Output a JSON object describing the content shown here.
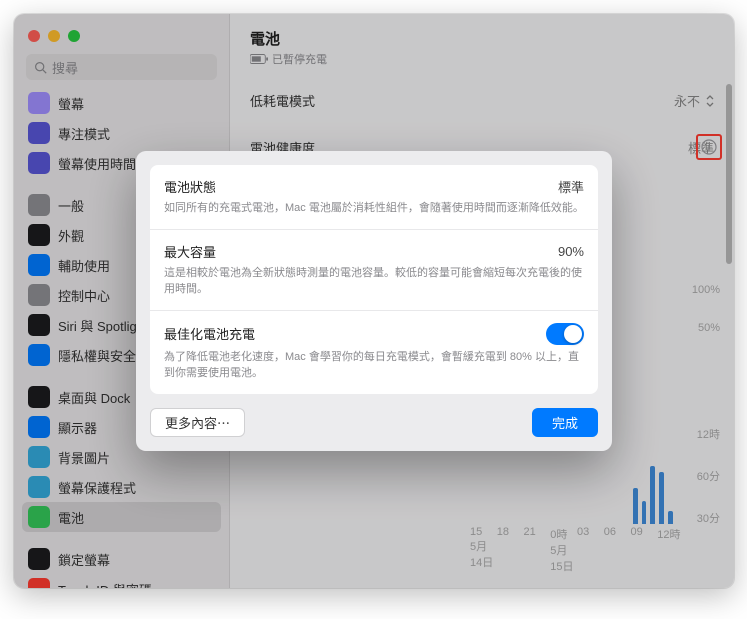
{
  "search": {
    "placeholder": "搜尋"
  },
  "sidebar": {
    "items": [
      {
        "label": "專注模式",
        "iconBg": "#5856d6"
      },
      {
        "label": "螢幕使用時間",
        "iconBg": "#5856d6"
      },
      {
        "label": "一般",
        "iconBg": "#8e8e93"
      },
      {
        "label": "外觀",
        "iconBg": "#1c1c1e"
      },
      {
        "label": "輔助使用",
        "iconBg": "#007aff"
      },
      {
        "label": "控制中心",
        "iconBg": "#8e8e93"
      },
      {
        "label": "Siri 與 Spotlight",
        "iconBg": "#1c1c1e"
      },
      {
        "label": "隱私權與安全性",
        "iconBg": "#007aff"
      },
      {
        "label": "桌面與 Dock",
        "iconBg": "#1c1c1e"
      },
      {
        "label": "顯示器",
        "iconBg": "#007aff"
      },
      {
        "label": "背景圖片",
        "iconBg": "#34aadc"
      },
      {
        "label": "螢幕保護程式",
        "iconBg": "#34aadc"
      },
      {
        "label": "電池",
        "iconBg": "#34c759",
        "selected": true
      },
      {
        "label": "鎖定螢幕",
        "iconBg": "#1c1c1e"
      },
      {
        "label": "Touch ID 與密碼",
        "iconBg": "#ff3b30"
      }
    ],
    "cutoff_top": "螢幕"
  },
  "header": {
    "title": "電池",
    "subtitle": "已暫停充電",
    "battery_icon": "battery"
  },
  "rows": {
    "low_power": {
      "label": "低耗電模式",
      "value": "永不"
    },
    "health": {
      "label": "電池健康度",
      "value": "標準"
    }
  },
  "modal": {
    "status": {
      "title": "電池狀態",
      "value": "標準",
      "desc": "如同所有的充電式電池，Mac 電池屬於消耗性組件，會隨著使用時間而逐漸降低效能。"
    },
    "capacity": {
      "title": "最大容量",
      "value": "90%",
      "desc": "這是相較於電池為全新狀態時測量的電池容量。較低的容量可能會縮短每次充電後的使用時間。"
    },
    "optimized": {
      "title": "最佳化電池充電",
      "on": true,
      "desc": "為了降低電池老化速度，Mac 會學習你的每日充電模式，會暫緩充電到 80% 以上，直到你需要使用電池。"
    },
    "more": "更多內容⋯",
    "done": "完成"
  },
  "chart_data": {
    "type": "bar",
    "ylabels": [
      "100%",
      "50%"
    ],
    "ylabels2": [
      "12時",
      "60分",
      "30分"
    ],
    "categories": [
      "15",
      "18",
      "21",
      "0時",
      "03",
      "06",
      "09",
      "12時"
    ],
    "dates": [
      "5月14日",
      "5月15日"
    ],
    "values": [
      0,
      0,
      0,
      0,
      0,
      0,
      0,
      0,
      0,
      0,
      0,
      0,
      0,
      0,
      0,
      0,
      0,
      0,
      28,
      18,
      45,
      40,
      10,
      0
    ]
  }
}
